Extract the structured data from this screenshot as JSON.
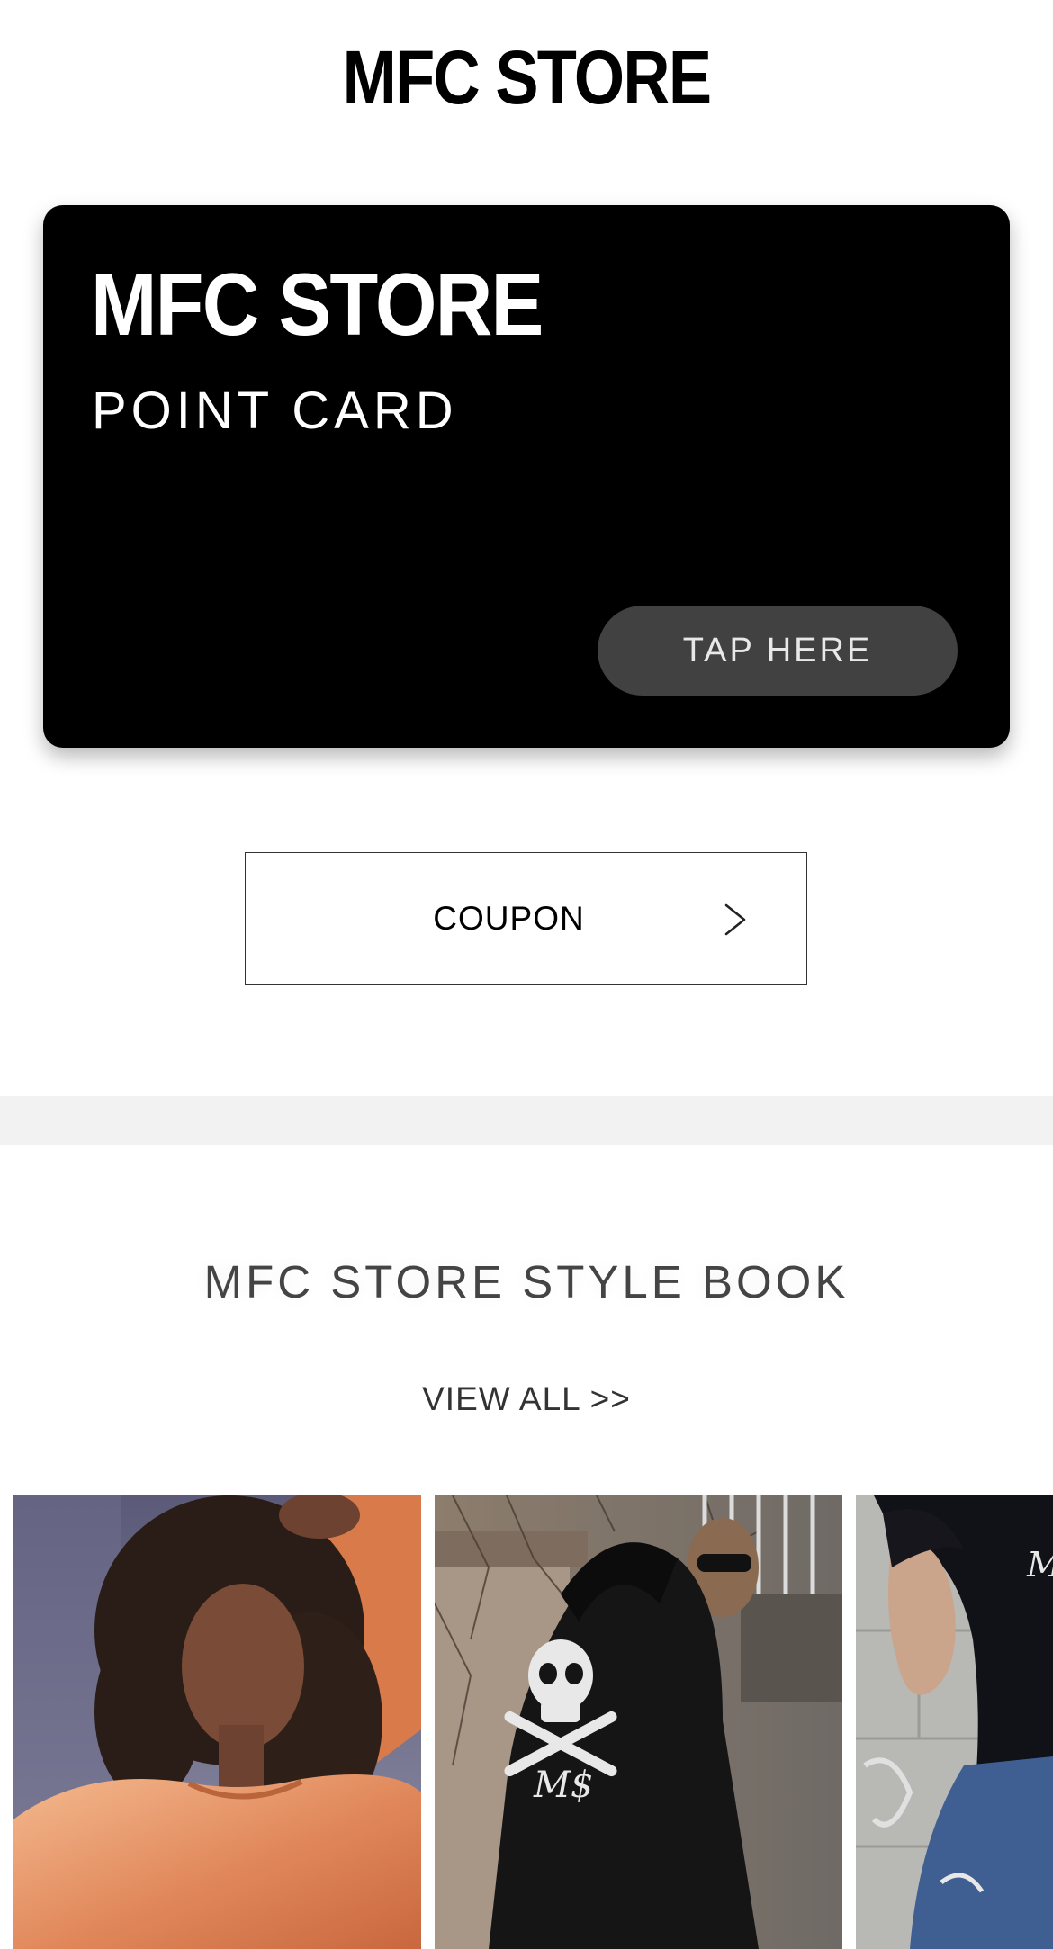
{
  "header": {
    "logo_text": "MFC STORE"
  },
  "point_card": {
    "logo_text": "MFC STORE",
    "subtitle": "POINT CARD",
    "tap_label": "TAP HERE"
  },
  "coupon": {
    "label": "COUPON",
    "icon": "chevron-right-icon"
  },
  "style_book": {
    "title": "MFC STORE STYLE BOOK",
    "view_all_label": "VIEW ALL >>",
    "photos": [
      {
        "subject": "woman-orange-sweatshirt"
      },
      {
        "subject": "man-black-hoodie-skull-print"
      },
      {
        "subject": "man-black-hoodie-denim-jacket"
      }
    ]
  },
  "colors": {
    "card_background": "#000000",
    "tap_button": "#414141",
    "divider_band": "#f2f2f2",
    "text_dark": "#444444"
  }
}
